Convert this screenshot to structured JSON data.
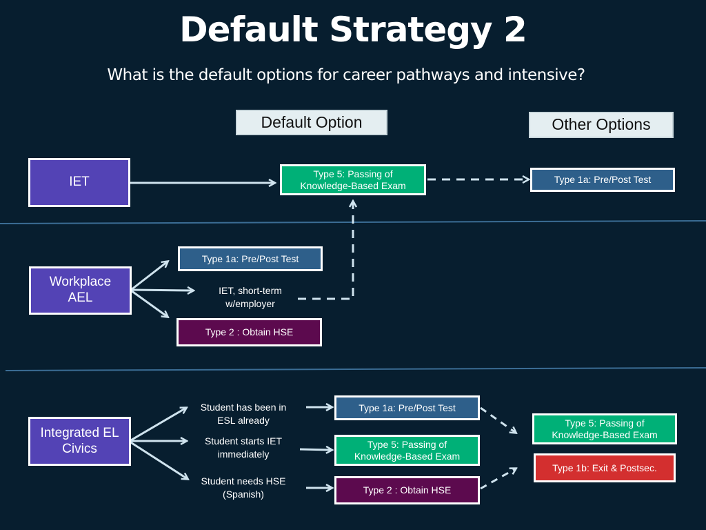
{
  "header": {
    "title": "Default Strategy 2",
    "subtitle": "What is the default options for career pathways and intensive?"
  },
  "column_headers": {
    "default": "Default Option",
    "other": "Other Options"
  },
  "section_iet": {
    "source": "IET",
    "default_option": "Type 5: Passing of Knowledge-Based Exam",
    "other_option": "Type 1a: Pre/Post Test"
  },
  "section_workplace": {
    "source": "Workplace AEL",
    "option_1": "Type 1a: Pre/Post Test",
    "option_2": "IET, short-term w/employer",
    "option_3": "Type 2 : Obtain HSE"
  },
  "section_elcivics": {
    "source": "Integrated EL Civics",
    "conditions": [
      "Student has been in ESL already",
      "Student starts IET immediately",
      "Student needs HSE (Spanish)"
    ],
    "defaults": [
      "Type 1a: Pre/Post Test",
      "Type 5: Passing of Knowledge-Based Exam",
      "Type 2 : Obtain HSE"
    ],
    "others": [
      "Type 5: Passing of Knowledge-Based Exam",
      "Type 1b: Exit & Postsec."
    ]
  },
  "colors": {
    "background": "#071e2f",
    "source_box": "#5343b5",
    "type5": "#00b077",
    "type1a": "#2e5f8a",
    "type2": "#5c0a4e",
    "type1b": "#d32f2f",
    "arrow": "#cfe3ee",
    "divider": "#3b6d95"
  }
}
